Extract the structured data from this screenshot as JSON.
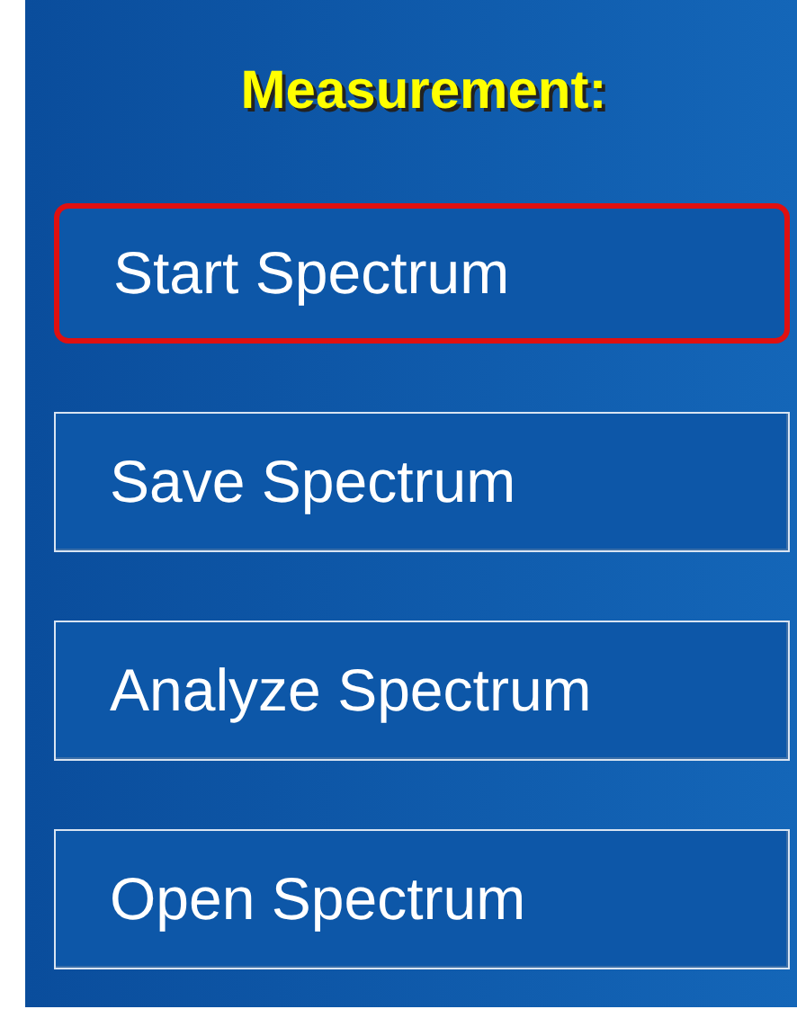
{
  "title": "Measurement:",
  "buttons": [
    {
      "label": "Start Spectrum",
      "selected": true
    },
    {
      "label": "Save Spectrum",
      "selected": false
    },
    {
      "label": "Analyze Spectrum",
      "selected": false
    },
    {
      "label": "Open Spectrum",
      "selected": false
    }
  ]
}
